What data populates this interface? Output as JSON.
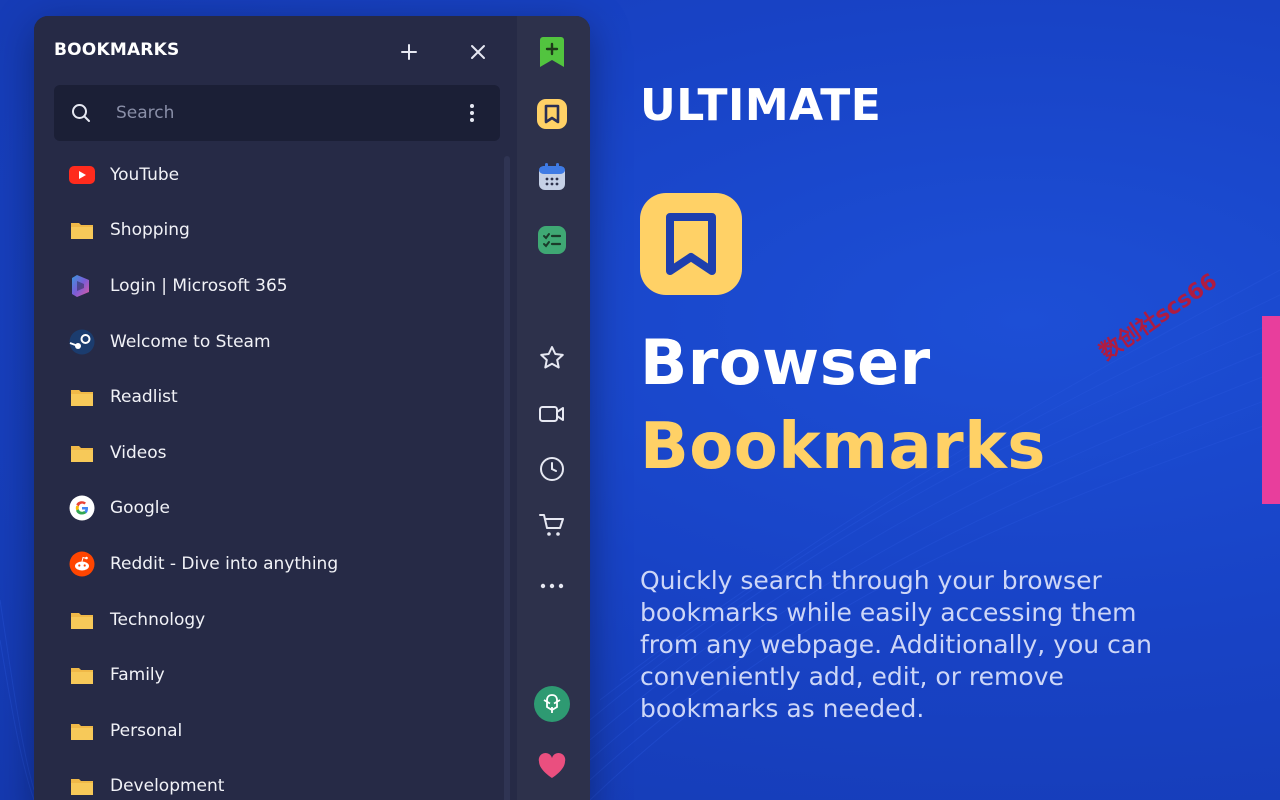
{
  "panel": {
    "title": "BOOKMARKS",
    "add_icon": "plus-icon",
    "close_icon": "close-icon",
    "search": {
      "placeholder": "Search",
      "value": ""
    },
    "items": [
      {
        "label": "YouTube",
        "icon": "youtube-icon"
      },
      {
        "label": "Shopping",
        "icon": "folder-icon"
      },
      {
        "label": "Login | Microsoft 365",
        "icon": "microsoft365-icon"
      },
      {
        "label": "Welcome to Steam",
        "icon": "steam-icon"
      },
      {
        "label": "Readlist",
        "icon": "folder-icon"
      },
      {
        "label": "Videos",
        "icon": "folder-icon"
      },
      {
        "label": "Google",
        "icon": "google-icon"
      },
      {
        "label": "Reddit - Dive into anything",
        "icon": "reddit-icon"
      },
      {
        "label": "Technology",
        "icon": "folder-icon"
      },
      {
        "label": "Family",
        "icon": "folder-icon"
      },
      {
        "label": "Personal",
        "icon": "folder-icon"
      },
      {
        "label": "Development",
        "icon": "folder-icon"
      }
    ]
  },
  "rail": {
    "buttons": [
      "add-bookmark-icon",
      "bookmarks-app-icon",
      "calendar-icon",
      "tasks-icon",
      "star-icon",
      "video-camera-icon",
      "clock-icon",
      "cart-icon",
      "more-icon",
      "chatgpt-icon",
      "heart-icon"
    ]
  },
  "hero": {
    "kicker": "ULTIMATE",
    "line1": "Browser",
    "line2": "Bookmarks",
    "description": "Quickly search through your browser bookmarks while easily accessing them from any webpage. Additionally, you can conveniently add, edit, or remove bookmarks as needed."
  },
  "watermark": "数创社scs66",
  "colors": {
    "background": "#1843c6",
    "panel": "#262a46",
    "rail": "#2d314b",
    "accent_yellow": "#ffd166",
    "edge_pink": "#e83e9c"
  }
}
